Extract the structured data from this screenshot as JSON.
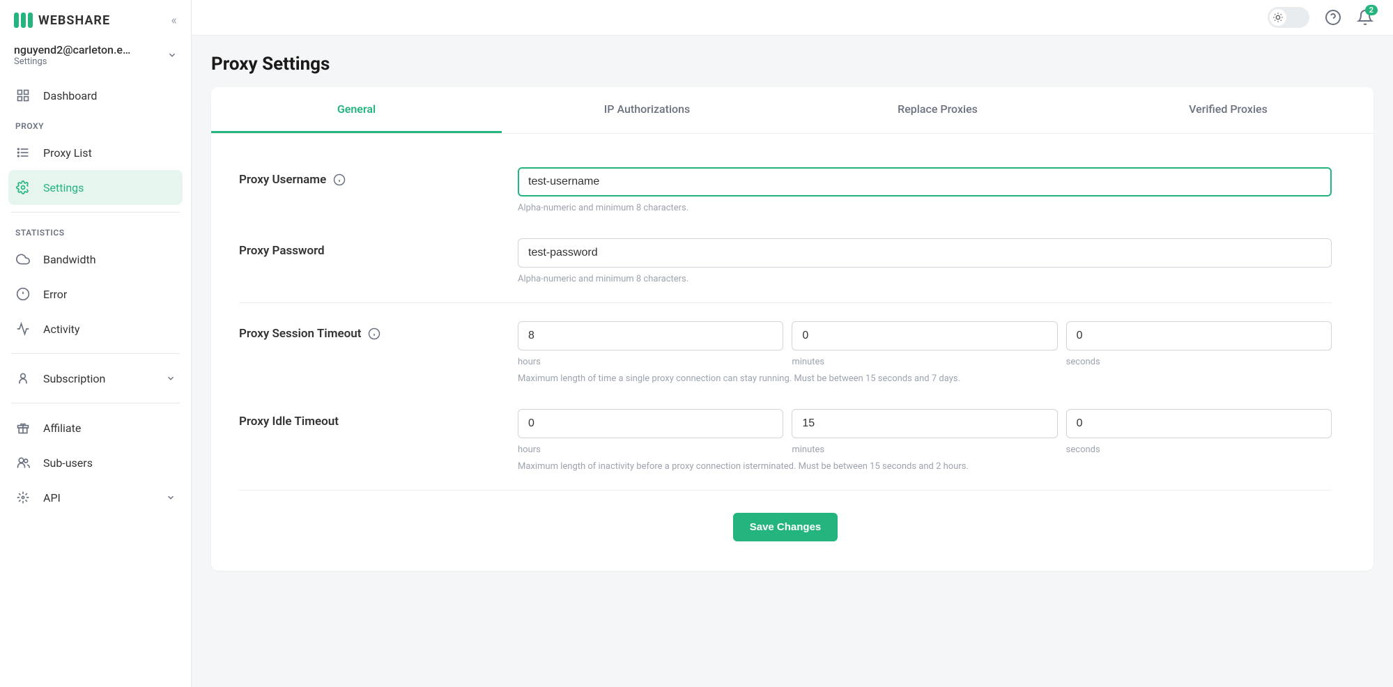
{
  "brand": "WEBSHARE",
  "user": {
    "email": "nguyend2@carleton.e…",
    "subtitle": "Settings"
  },
  "nav": {
    "dashboard": "Dashboard",
    "section_proxy": "PROXY",
    "proxy_list": "Proxy List",
    "settings": "Settings",
    "section_stats": "STATISTICS",
    "bandwidth": "Bandwidth",
    "error": "Error",
    "activity": "Activity",
    "subscription": "Subscription",
    "affiliate": "Affiliate",
    "subusers": "Sub-users",
    "api": "API"
  },
  "notifications": {
    "count": "2"
  },
  "page": {
    "title": "Proxy Settings"
  },
  "tabs": {
    "general": "General",
    "ip": "IP Authorizations",
    "replace": "Replace Proxies",
    "verified": "Verified Proxies"
  },
  "form": {
    "username": {
      "label": "Proxy Username",
      "value": "test-username",
      "helper": "Alpha-numeric and minimum 8 characters."
    },
    "password": {
      "label": "Proxy Password",
      "value": "test-password",
      "helper": "Alpha-numeric and minimum 8 characters."
    },
    "session": {
      "label": "Proxy Session Timeout",
      "hours": "8",
      "minutes": "0",
      "seconds": "0",
      "helper": "Maximum length of time a single proxy connection can stay running. Must be between 15 seconds and 7 days."
    },
    "idle": {
      "label": "Proxy Idle Timeout",
      "hours": "0",
      "minutes": "15",
      "seconds": "0",
      "helper": "Maximum length of inactivity before a proxy connection isterminated. Must be between 15 seconds and 2 hours."
    },
    "units": {
      "hours": "hours",
      "minutes": "minutes",
      "seconds": "seconds"
    },
    "save": "Save Changes"
  }
}
